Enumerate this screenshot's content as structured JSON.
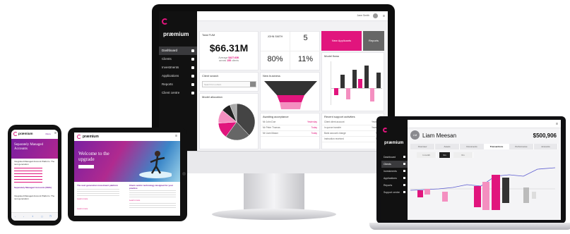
{
  "brand": "præmium",
  "colors": {
    "accent": "#e1157d",
    "sidebar": "#111111",
    "dark_bar": "#333333"
  },
  "desktop": {
    "user": "Jane Smith",
    "nav": [
      "Dashboard",
      "Clients",
      "Investments",
      "Applications",
      "Reports",
      "Client centre"
    ],
    "fum": {
      "title": "Total FUM",
      "value": "$66.31M",
      "avg_label": "Average",
      "avg_value": "$427.63K",
      "across_label": "across",
      "count": "155",
      "count_suffix": "clients"
    },
    "client_box": {
      "name": "JOHN SMITH",
      "count": "5"
    },
    "stats": {
      "a": "80%",
      "b": "11%"
    },
    "buttons": {
      "new_applicants": "New Applicants",
      "reports": "Reports"
    },
    "client_search": {
      "title": "Client search",
      "placeholder": "Search for a client"
    },
    "new_business": {
      "title": "New business"
    },
    "model_flows": {
      "title": "Model flows"
    },
    "model_allocation": {
      "title": "Model allocation"
    },
    "awaiting": {
      "title": "Awaiting acceptance",
      "rows": [
        [
          "Mr John Doe",
          "Yesterday"
        ],
        [
          "Mr Peter Thomas",
          "Today"
        ],
        [
          "Mr Liam Mason",
          "Today"
        ]
      ]
    },
    "support": {
      "title": "Recent support activities",
      "rows": [
        [
          "Client client account",
          "Yesterday"
        ],
        [
          "In queue transfer",
          "Yesterday"
        ],
        [
          "Bank account change",
          "Today"
        ],
        [
          "Instruction received",
          "Today"
        ]
      ]
    },
    "chart_data": [
      {
        "type": "pie",
        "title": "Model allocation",
        "values": [
          38,
          22,
          14,
          12,
          8,
          6
        ],
        "colors": [
          "#444444",
          "#666666",
          "#e1157d",
          "#f48fc0",
          "#222222",
          "#aaaaaa"
        ]
      },
      {
        "type": "bar",
        "title": "Model flows",
        "values": [
          -3,
          6,
          -5,
          8,
          4,
          10,
          -6,
          7
        ],
        "colors": [
          "#e1157d",
          "#333333",
          "#f48fc0",
          "#333333",
          "#e1157d",
          "#333333",
          "#f48fc0",
          "#333333"
        ]
      }
    ]
  },
  "laptop": {
    "client_name": "Liam Meesan",
    "initials": "LM",
    "value": "$500,906",
    "tabs": [
      "Overview",
      "Assets",
      "Documents",
      "Transactions",
      "Performance",
      "Accounts"
    ],
    "active_tab": 3,
    "subtabs": [
      "1 month",
      "3m",
      "6m"
    ],
    "nav": [
      "Dashboard",
      "Clients",
      "Investments",
      "Applications",
      "Reports",
      "Support centre"
    ]
  },
  "tablet": {
    "hero_line1": "Welcome to the",
    "hero_line2": "upgrade",
    "left_title": "The next generation investment platform",
    "right_title": "Client centric technology designed for your practice",
    "link": "Learn more"
  },
  "phone": {
    "menu": "Menu",
    "heading": "Separately Managed Accounts",
    "text1": "Integrated Managed Account Platform. The next generation",
    "heading2": "Separately Managed Accounts (SMA)",
    "text2": "Integrated Managed Account Platform. The next generation"
  }
}
